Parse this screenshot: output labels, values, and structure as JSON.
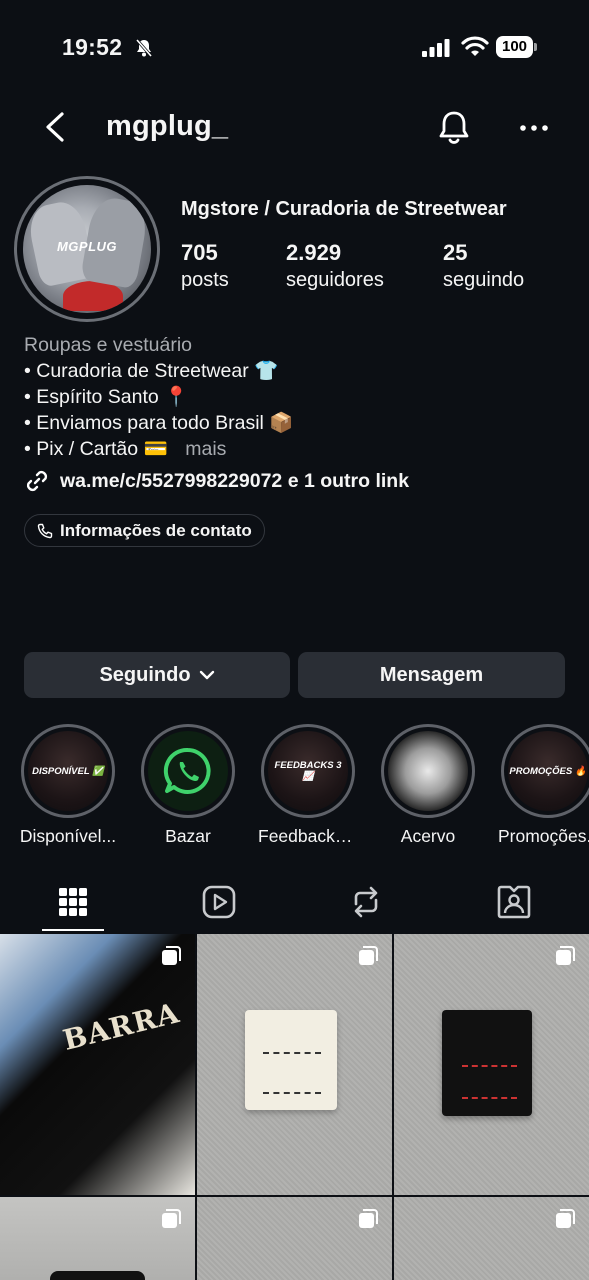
{
  "status_bar": {
    "time": "19:52",
    "battery": "100"
  },
  "header": {
    "username": "mgplug_"
  },
  "profile": {
    "avatar_text": "MGPLUG",
    "display_name": "Mgstore / Curadoria de Streetwear",
    "stats": [
      {
        "value": "705",
        "label": "posts"
      },
      {
        "value": "2.929",
        "label": "seguidores"
      },
      {
        "value": "25",
        "label": "seguindo"
      }
    ],
    "bio": {
      "category": "Roupas e vestuário",
      "lines": [
        "• Curadoria de Streetwear 👕",
        "• Espírito Santo 📍",
        "• Enviamos para todo Brasil 📦",
        "• Pix / Cartão 💳"
      ],
      "more": "mais"
    },
    "link": "wa.me/c/5527998229072 e 1 outro link",
    "contact": "Informações de contato"
  },
  "actions": {
    "following": "Seguindo",
    "message": "Mensagem"
  },
  "highlights": [
    {
      "cover_text": "DISPONÍVEL ✅",
      "label": "Disponível..."
    },
    {
      "cover_text": "",
      "label": "Bazar"
    },
    {
      "cover_text": "FEEDBACKS 3 📈",
      "label": "Feedbacks..."
    },
    {
      "cover_text": "",
      "label": "Acervo"
    },
    {
      "cover_text": "PROMOÇÕES 🔥",
      "label": "Promoções..."
    }
  ],
  "tabs": [
    "grid-icon",
    "reels-icon",
    "reposts-icon",
    "tagged-icon"
  ],
  "grid": {
    "barra_text": "BARRA"
  },
  "colors": {
    "background": "#0c0f14",
    "button": "#2a2e35",
    "secondary_text": "#a8abb0"
  }
}
